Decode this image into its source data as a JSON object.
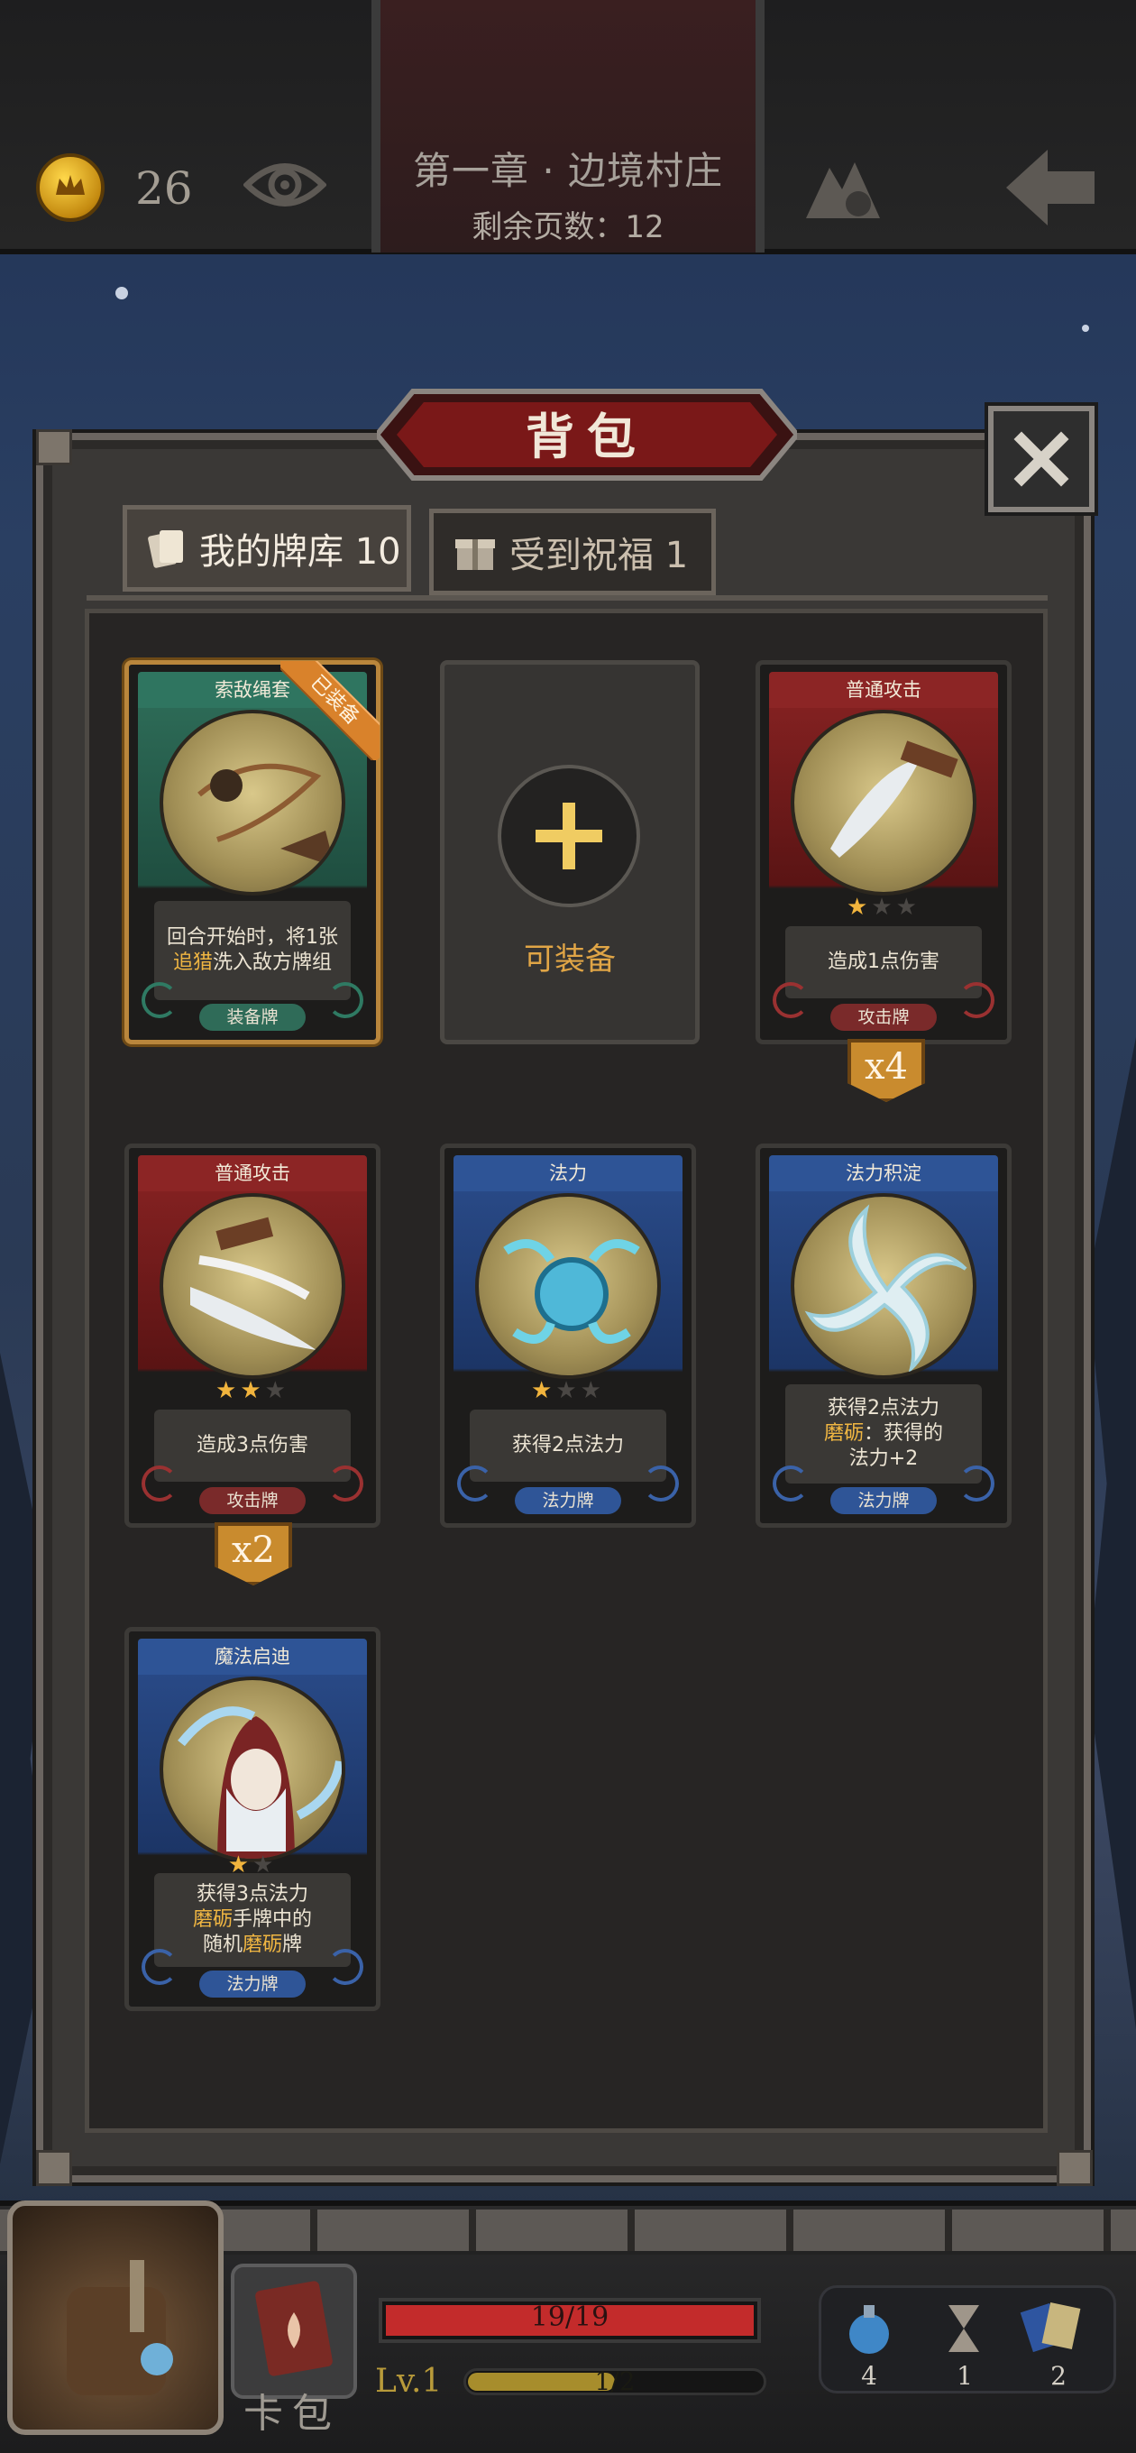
{
  "header": {
    "coins": "26",
    "chapter_title": "第一章 · 边境村庄",
    "pages_remaining": "剩余页数：12"
  },
  "panel": {
    "title": "背包",
    "tabs": [
      {
        "label": "我的牌库 10",
        "icon": "cards-icon",
        "active": true
      },
      {
        "label": "受到祝福 1",
        "icon": "gift-icon",
        "active": false
      }
    ],
    "empty_slot_label": "可装备"
  },
  "cards": [
    {
      "name": "索敌绳套",
      "color": "green",
      "equipped_badge": "已装备",
      "stars": null,
      "desc": [
        "回合开始时，将1张",
        {
          "hl": "追猎"
        },
        "洗入敌方牌组"
      ],
      "type": "装备牌",
      "count": null
    },
    {
      "name": "普通攻击",
      "color": "red",
      "stars": 1,
      "desc": [
        "造成1点伤害"
      ],
      "type": "攻击牌",
      "count": "x4"
    },
    {
      "name": "普通攻击",
      "color": "red",
      "stars": 2,
      "desc": [
        "造成3点伤害"
      ],
      "type": "攻击牌",
      "count": "x2"
    },
    {
      "name": "法力",
      "color": "blue",
      "stars": 1,
      "desc": [
        "获得2点法力"
      ],
      "type": "法力牌",
      "count": null
    },
    {
      "name": "法力积淀",
      "color": "blue",
      "stars": null,
      "desc": [
        "获得2点法力",
        {
          "hl": "磨砺"
        },
        "：获得的",
        "法力+2"
      ],
      "type": "法力牌",
      "count": null
    },
    {
      "name": "魔法启迪",
      "color": "blue",
      "stars": 1,
      "desc": [
        "获得3点法力",
        {
          "hl": "磨砺"
        },
        "手牌中的",
        "随机",
        {
          "hl": "磨砺"
        },
        "牌"
      ],
      "type": "法力牌",
      "count": null
    }
  ],
  "hud": {
    "hp": "19/19",
    "hp_fraction": 1.0,
    "level": "Lv.1",
    "xp": "1/2",
    "xp_fraction": 0.5,
    "book_label": "卡包",
    "resources": [
      {
        "icon": "potion-icon",
        "value": "4"
      },
      {
        "icon": "hourglass-icon",
        "value": "1"
      },
      {
        "icon": "card-stack-icon",
        "value": "2"
      }
    ]
  },
  "colors": {
    "accent_gold": "#e0a546",
    "highlight": "#f0b642",
    "hp_red": "#c32b2b"
  }
}
